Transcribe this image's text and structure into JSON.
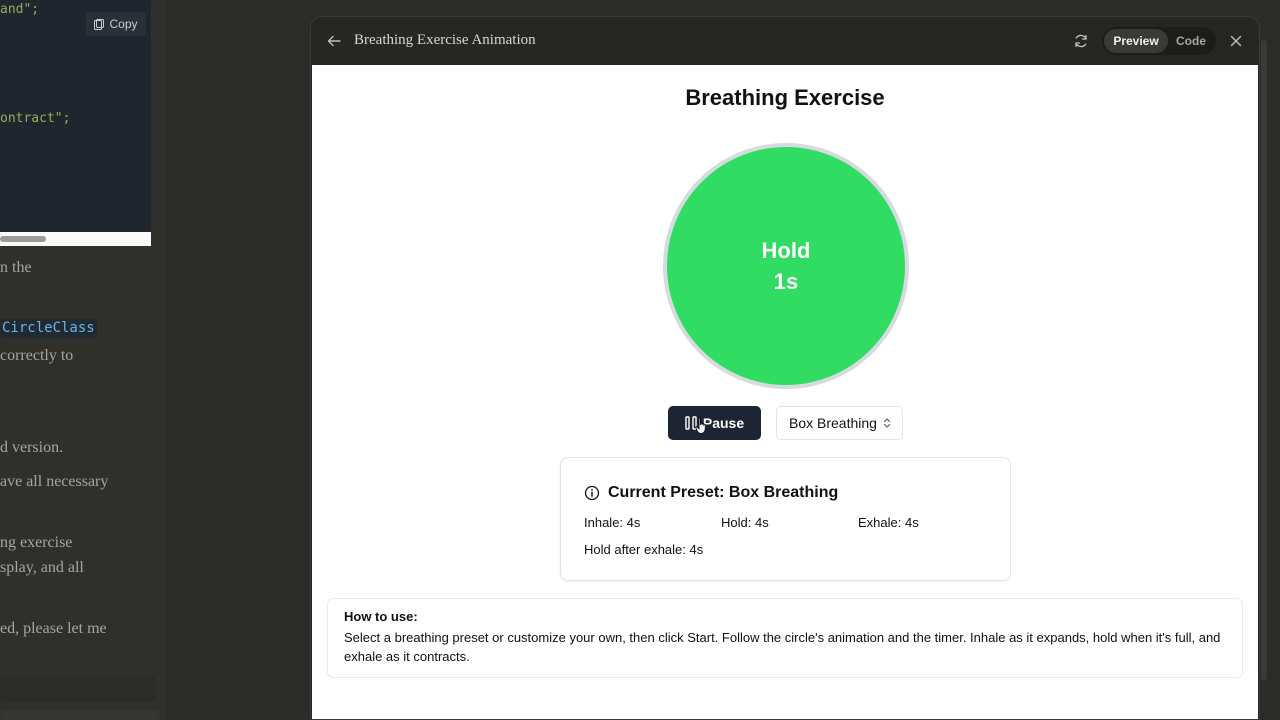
{
  "chat": {
    "code_lines": [
      "and\";",
      "ontract\";"
    ],
    "copy_label": "Copy",
    "inline_code": "CircleClass",
    "lines": [
      "n the",
      "correctly to",
      "d version.",
      "ave all necessary",
      "ng exercise",
      "splay, and all",
      "ed, please let me"
    ]
  },
  "panel": {
    "title": "Breathing Exercise Animation",
    "toggle": {
      "preview": "Preview",
      "code": "Code"
    }
  },
  "app": {
    "title": "Breathing Exercise",
    "phase": "Hold",
    "timer": "1s",
    "pause_label": "Pause",
    "preset_selected": "Box Breathing",
    "info": {
      "heading": "Current Preset: Box Breathing",
      "inhale": "Inhale: 4s",
      "hold": "Hold: 4s",
      "exhale": "Exhale: 4s",
      "hold_after": "Hold after exhale: 4s"
    },
    "howto": {
      "title": "How to use:",
      "text": "Select a breathing preset or customize your own, then click Start. Follow the circle's animation and the timer. Inhale as it expands, hold when it's full, and exhale as it contracts."
    }
  },
  "colors": {
    "circle": "#30dc62",
    "button_dark": "#1d2533",
    "panel_bg": "#262624"
  },
  "icons": [
    "copy-icon",
    "back-arrow-icon",
    "refresh-icon",
    "close-icon",
    "pause-icon",
    "chevron-updown-icon",
    "info-icon",
    "cursor-hand-icon"
  ]
}
